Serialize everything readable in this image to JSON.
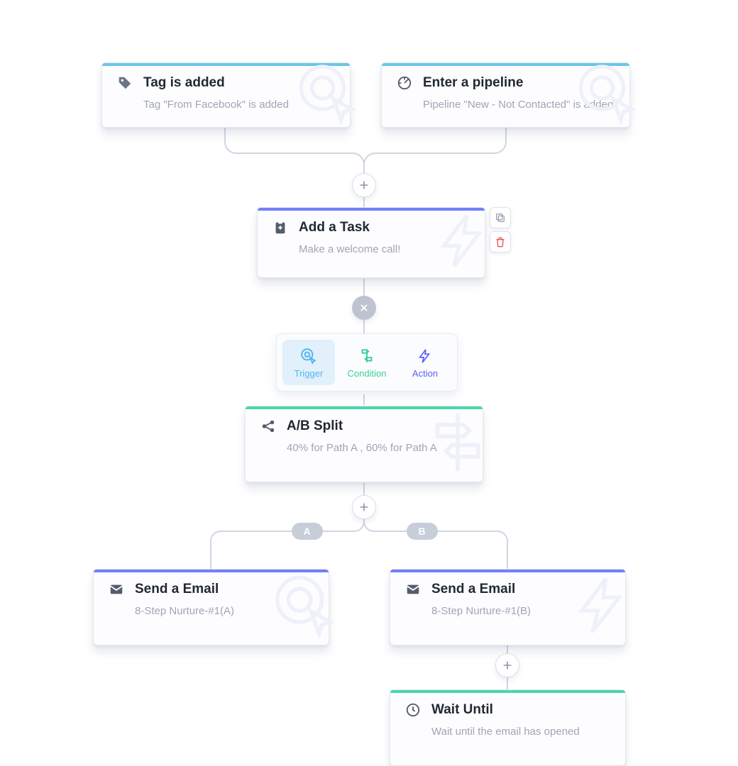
{
  "cards": {
    "tag": {
      "title": "Tag is added",
      "sub": "Tag \"From Facebook\" is added"
    },
    "pipeline": {
      "title": "Enter a pipeline",
      "sub": "Pipeline \"New - Not Contacted\" is added"
    },
    "task": {
      "title": "Add a Task",
      "sub": "Make a welcome call!"
    },
    "split": {
      "title": "A/B Split",
      "sub": "40% for Path A , 60% for Path A"
    },
    "emailA": {
      "title": "Send a Email",
      "sub": "8-Step Nurture-#1(A)"
    },
    "emailB": {
      "title": "Send a Email",
      "sub": "8-Step Nurture-#1(B)"
    },
    "wait": {
      "title": "Wait Until",
      "sub": "Wait until the email has opened"
    }
  },
  "selector": {
    "trigger": "Trigger",
    "condition": "Condition",
    "action": "Action"
  },
  "paths": {
    "A": "A",
    "B": "B"
  },
  "icons": {
    "tag": "tag-add-icon",
    "pipeline": "target-arrow-icon",
    "task": "clipboard-plus-icon",
    "split": "share-split-icon",
    "email": "envelope-icon",
    "wait": "clock-icon",
    "bolt": "bolt-icon",
    "cursor_target": "cursor-target-icon",
    "signpost": "signpost-icon",
    "copy": "copy-icon",
    "trash": "trash-icon",
    "close": "close-icon",
    "plus": "plus-icon"
  }
}
